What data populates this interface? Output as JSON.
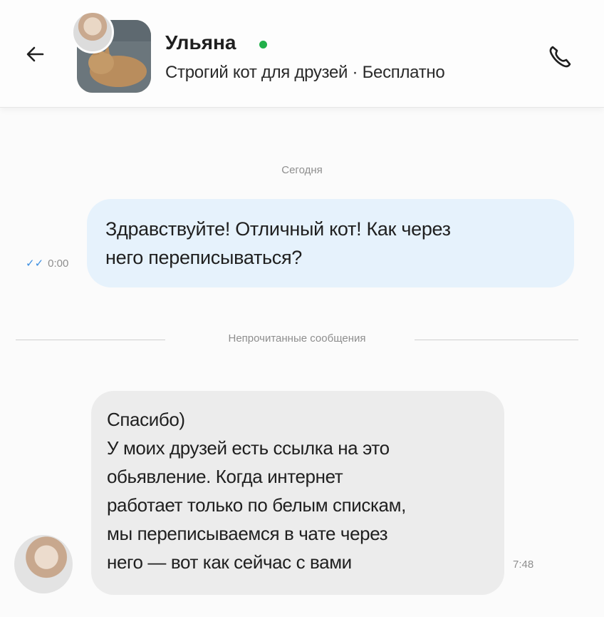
{
  "header": {
    "seller_name": "Ульяна",
    "listing_subtitle": "Строгий кот для друзей · Бесплатно",
    "online": true,
    "online_color": "#22b04a",
    "icons": {
      "back": "arrow-left-icon",
      "call": "phone-icon"
    }
  },
  "chat": {
    "date_label": "Сегодня",
    "outgoing": {
      "lines": [
        "Здравствуйте! Отличный кот! Как через",
        "него переписываться?"
      ],
      "checks": "✓✓",
      "time": "0:00",
      "bubble_color": "#e6f2fc"
    },
    "unread_divider": "Непрочитанные сообщения",
    "incoming": {
      "lines": [
        "Спасибо)",
        "У моих друзей есть ссылка на это",
        "обьявление. Когда интернет",
        "работает только по белым спискам,",
        "мы переписываемся в чате через",
        "него — вот как сейчас с вами"
      ],
      "time": "7:48",
      "bubble_color": "#ececec"
    }
  }
}
